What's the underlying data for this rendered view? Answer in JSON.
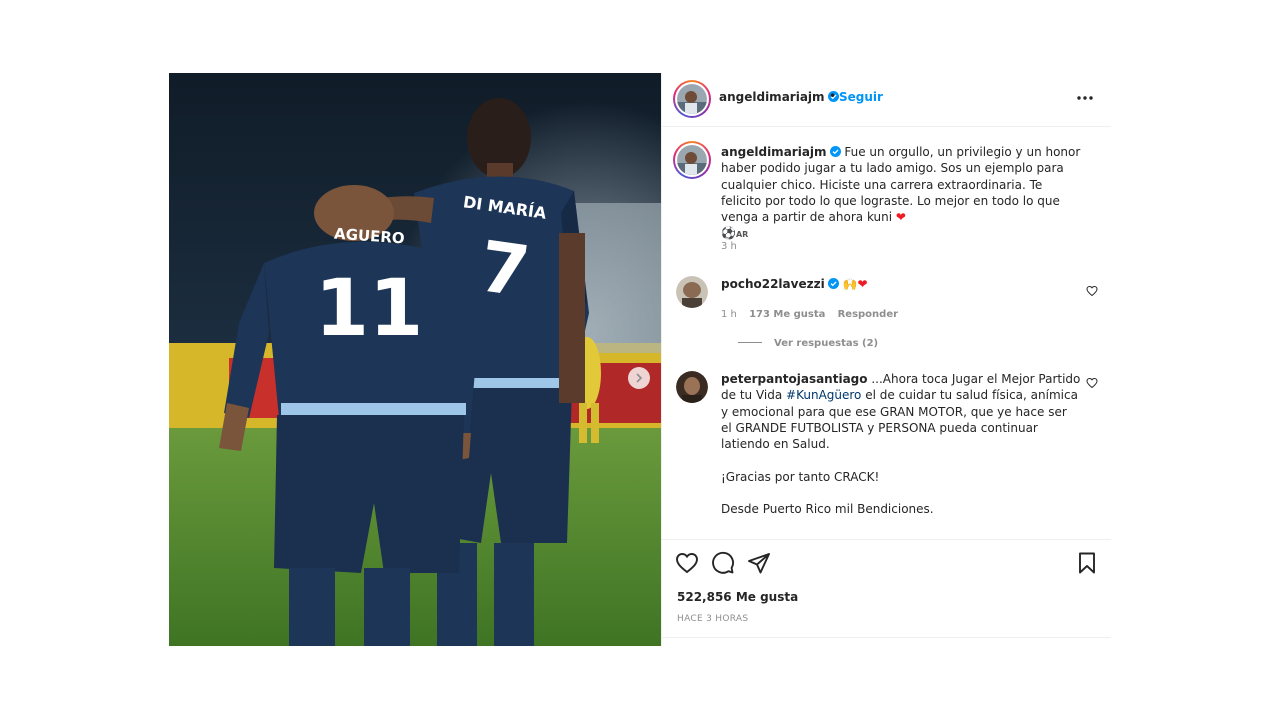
{
  "post": {
    "author": "angeldimariajm",
    "follow_label": "Seguir",
    "separator": "•",
    "likes": "522,856 Me gusta",
    "time_ago": "HACE 3 HORAS"
  },
  "photo": {
    "jersey_left_name": "AGUERO",
    "jersey_left_number": "11",
    "jersey_right_name": "DI MARÍA",
    "jersey_right_number": "7"
  },
  "caption": {
    "username": "angeldimariajm",
    "text_part1": "Fue un orgullo, un privilegio y un honor haber podido jugar a tu lado amigo. Sos un ejemplo para cualquier chico. Hiciste una carrera extraordinaria. Te felicito por todo lo que lograste. Lo mejor en todo lo que venga a partir de ahora kuni",
    "emoji_heart": "❤",
    "emoji_ball": "⚽",
    "flag_text": "AR",
    "time": "3 h"
  },
  "comments": [
    {
      "username": "pocho22lavezzi",
      "emoji": "🙌",
      "heart": "❤",
      "time": "1 h",
      "likes": "173 Me gusta",
      "reply_label": "Responder",
      "view_replies": "Ver respuestas (2)"
    },
    {
      "username": "peterpantojasantiago",
      "text_a": "...Ahora toca Jugar el Mejor Partido de tu Vida",
      "hashtag": "#KunAgüero",
      "text_b": "el de cuidar tu salud física, anímica y emocional para que ese GRAN MOTOR, que ye hace ser el GRANDE FUTBOLISTA y PERSONA pueda continuar latiendo en Salud.",
      "line2": "¡Gracias por tanto CRACK!",
      "line3": "Desde Puerto Rico mil Bendiciones."
    }
  ],
  "colors": {
    "link": "#0095f6",
    "verified": "#0095f6",
    "muted": "#8e8e8e",
    "text": "#262626",
    "heart": "#ed1c24",
    "jersey": "#1d3557"
  },
  "icons": [
    "verified-badge-icon",
    "more-options-icon",
    "heart-icon",
    "comment-icon",
    "share-icon",
    "bookmark-icon",
    "chevron-right-icon"
  ]
}
